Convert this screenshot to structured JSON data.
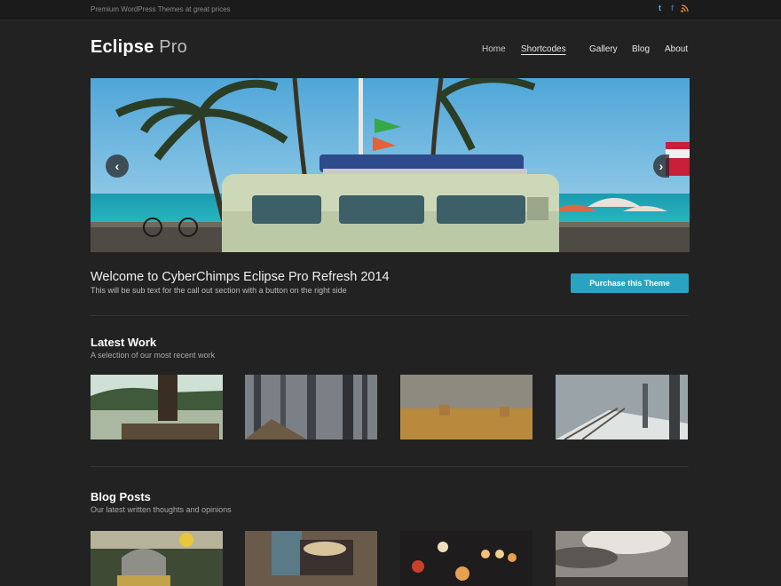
{
  "topbar": {
    "tagline": "Premium WordPress Themes at great prices",
    "social_icons": [
      "twitter-icon",
      "facebook-icon",
      "rss-icon"
    ]
  },
  "header": {
    "logo_main": "Eclipse",
    "logo_suffix": " Pro",
    "nav": [
      "Home",
      "Shortcodes",
      "Gallery",
      "Blog",
      "About"
    ]
  },
  "slider": {
    "prev_icon": "chevron-left-icon",
    "next_icon": "chevron-right-icon"
  },
  "callout": {
    "title": "Welcome to CyberChimps Eclipse Pro Refresh 2014",
    "subtitle": "This will be sub text for the call out section with a button on the right side",
    "button": "Purchase this Theme",
    "button_color": "#2aa3c0"
  },
  "latest_work": {
    "title": "Latest Work",
    "subtitle": "A selection of our most recent work"
  },
  "blog_posts": {
    "title": "Blog Posts",
    "subtitle": "Our latest written thoughts and opinions"
  },
  "colors": {
    "background": "#222222",
    "accent": "#2aa3c0"
  }
}
